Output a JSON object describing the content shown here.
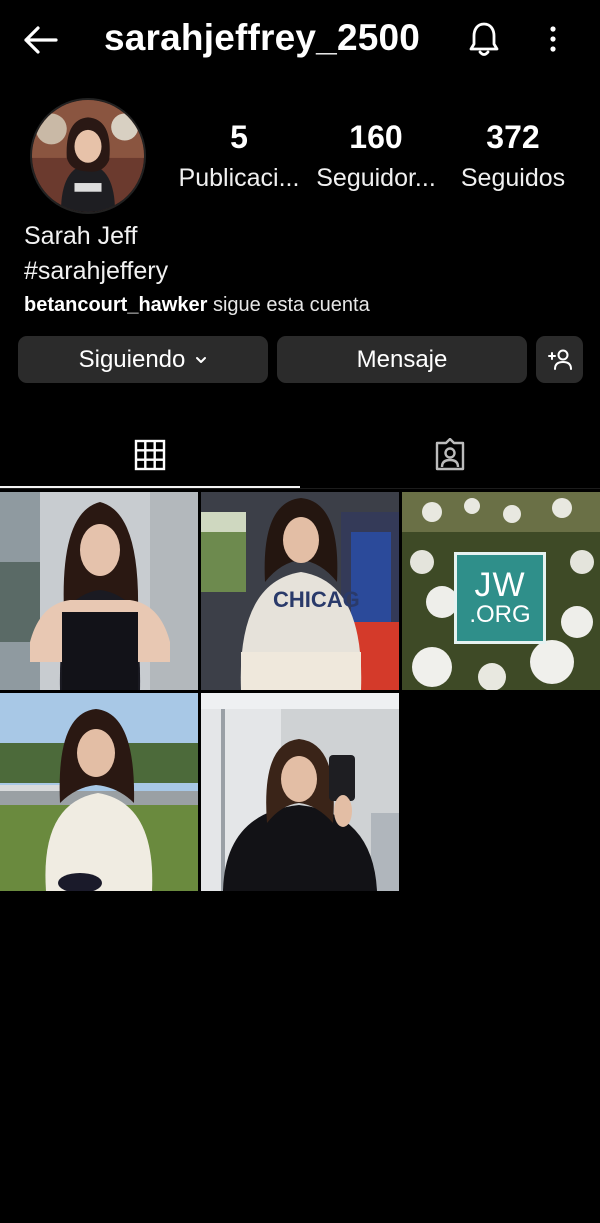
{
  "header": {
    "username": "sarahjeffrey_2500",
    "back_icon": "back-arrow-icon",
    "notifications_icon": "bell-icon",
    "menu_icon": "more-vertical-icon"
  },
  "profile": {
    "avatar_alt": "profile-picture",
    "stats": [
      {
        "value": "5",
        "label": "Publicaci..."
      },
      {
        "value": "160",
        "label": "Seguidor..."
      },
      {
        "value": "372",
        "label": "Seguidos"
      }
    ],
    "name": "Sarah Jeff",
    "bio": "#sarahjeffery",
    "followed_by_user": "betancourt_hawker",
    "followed_by_text": " sigue esta cuenta"
  },
  "actions": {
    "following_label": "Siguiendo",
    "message_label": "Mensaje",
    "add_user_icon": "add-user-icon"
  },
  "tabs": [
    {
      "name": "posts-grid",
      "icon": "grid-icon",
      "active": true
    },
    {
      "name": "tagged",
      "icon": "tagged-person-icon",
      "active": false
    }
  ],
  "posts": [
    {
      "id": 1
    },
    {
      "id": 2
    },
    {
      "id": 3,
      "badge_line1": "JW",
      "badge_line2": ".ORG"
    },
    {
      "id": 4
    },
    {
      "id": 5
    }
  ],
  "colors": {
    "background": "#000000",
    "button_bg": "#2b2b2b",
    "text": "#f2f2f2",
    "jw_teal": "#2f8f8a"
  }
}
